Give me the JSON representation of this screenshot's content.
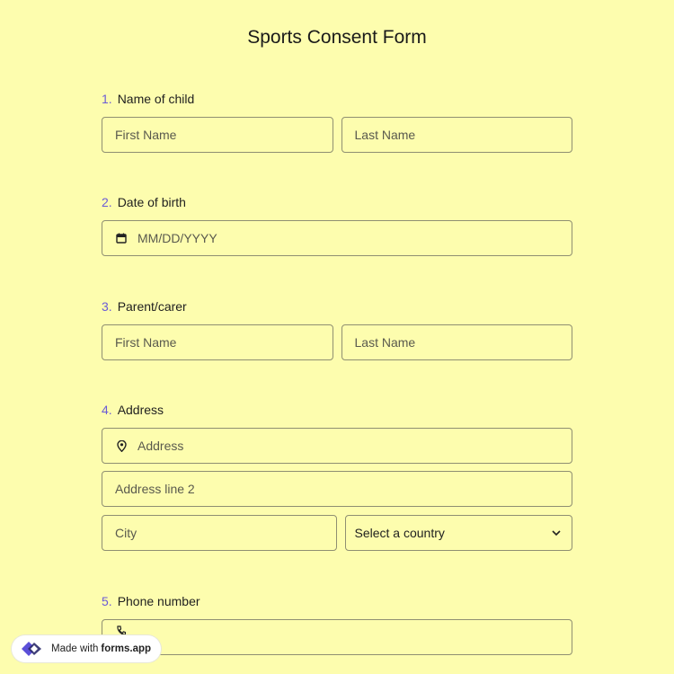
{
  "form": {
    "title": "Sports Consent Form"
  },
  "questions": [
    {
      "num": "1.",
      "label": "Name of child",
      "fields": [
        "First Name",
        "Last Name"
      ]
    },
    {
      "num": "2.",
      "label": "Date of birth",
      "fields": [
        "MM/DD/YYYY"
      ]
    },
    {
      "num": "3.",
      "label": "Parent/carer",
      "fields": [
        "First Name",
        "Last Name"
      ]
    },
    {
      "num": "4.",
      "label": "Address",
      "address": "Address",
      "address2": "Address line 2",
      "city": "City",
      "country": "Select a country"
    },
    {
      "num": "5.",
      "label": "Phone number"
    }
  ],
  "badge": {
    "prefix": "Made with",
    "brand": "forms.app"
  },
  "colors": {
    "background": "#fdfdae",
    "accent": "#6b5bd6",
    "border": "#8f8f72"
  },
  "icons": {
    "date": "calendar-icon",
    "address": "map-pin-icon",
    "country": "chevron-down-icon",
    "phone": "phone-icon"
  }
}
